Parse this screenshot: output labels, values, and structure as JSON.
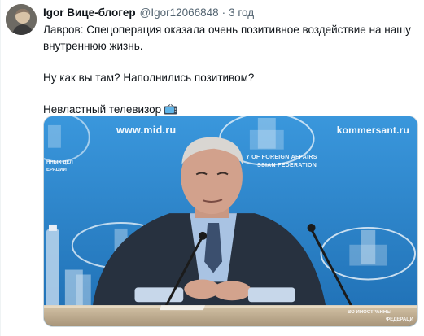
{
  "tweet": {
    "author_name": "Igor Вице-блогер",
    "author_handle": "@Igor12066848",
    "separator": "·",
    "time": "3 год",
    "line1": "Лавров: Спецоперация оказала очень позитивное воздействие на нашу внутреннюю жизнь.",
    "line2": "Ну как вы там? Наполнились позитивом?",
    "line3": "Невластный телевизор",
    "emoji": "tv-icon"
  },
  "media": {
    "watermark_left": "www.mid.ru",
    "watermark_right": "kommersant.ru",
    "emblem_line1": "Y OF FOREIGN AFFAIRS",
    "emblem_line2": "SSIAN FEDERATION",
    "side_line1": "ННЫХ ДЕЛ",
    "side_line2": "ЕРАЦИИ",
    "bottom_line1": "ВО ИНОСТРАННЫ",
    "bottom_line2": "ФЕДЕРАЦИ"
  },
  "colors": {
    "backdrop": "#2f88cf",
    "suit": "#2a3442",
    "table": "#c9b79a",
    "muted_text": "#536471"
  }
}
